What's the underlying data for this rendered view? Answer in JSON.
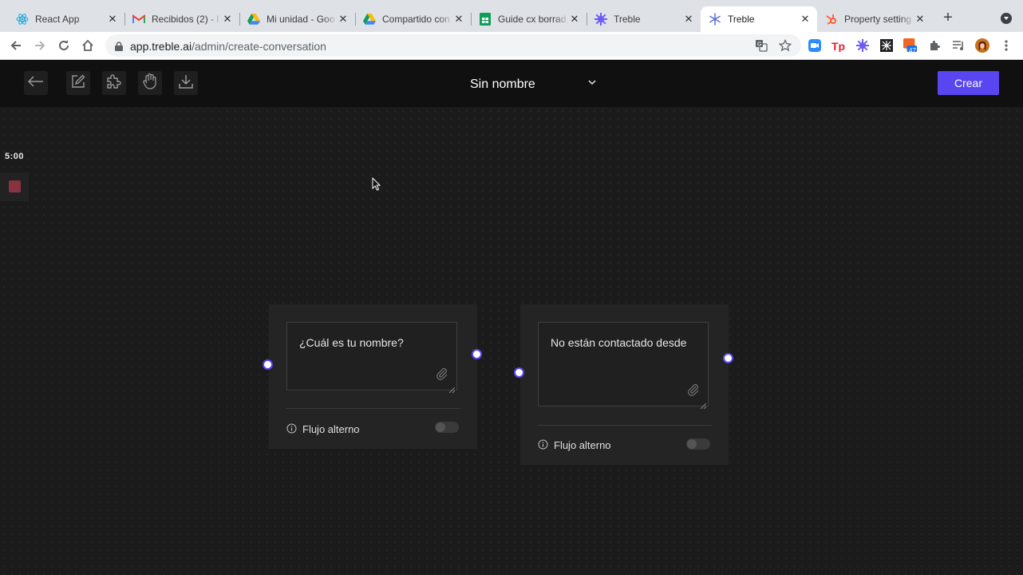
{
  "browser": {
    "tabs": [
      {
        "title": "React App",
        "icon": "react-icon",
        "active": false
      },
      {
        "title": "Recibidos (2) - l",
        "icon": "gmail-icon",
        "active": false
      },
      {
        "title": "Mi unidad - Goo",
        "icon": "google-drive-icon",
        "active": false
      },
      {
        "title": "Compartido con",
        "icon": "google-drive-icon",
        "active": false
      },
      {
        "title": "Guide cx borrad",
        "icon": "google-sheets-icon",
        "active": false
      },
      {
        "title": "Treble",
        "icon": "treble-icon",
        "active": false
      },
      {
        "title": "Treble",
        "icon": "treble-snowflake-icon",
        "active": true
      },
      {
        "title": "Property setting",
        "icon": "hubspot-icon",
        "active": false
      }
    ],
    "url_host": "app.treble.ai",
    "url_path": "/admin/create-conversation",
    "extensions_badge": "47",
    "accent_colors": {
      "react": "#61dafb",
      "gmail": "#ea4335",
      "sheets": "#0f9d58",
      "treble": "#6b5cf5",
      "hubspot": "#ff5c35"
    }
  },
  "app": {
    "conversation_title": "Sin nombre",
    "create_button": "Crear",
    "accent_color": "#5a46f0",
    "toolbar_icons": [
      "back-arrow-icon",
      "edit-icon",
      "puzzle-icon",
      "hand-icon",
      "download-icon"
    ]
  },
  "recorder": {
    "timer": "5:00"
  },
  "nodes": [
    {
      "message": "¿Cuál es tu nombre?",
      "alt_flow_label": "Flujo alterno",
      "alt_flow_enabled": false
    },
    {
      "message": "No están contactado desde",
      "alt_flow_label": "Flujo alterno",
      "alt_flow_enabled": false
    }
  ]
}
